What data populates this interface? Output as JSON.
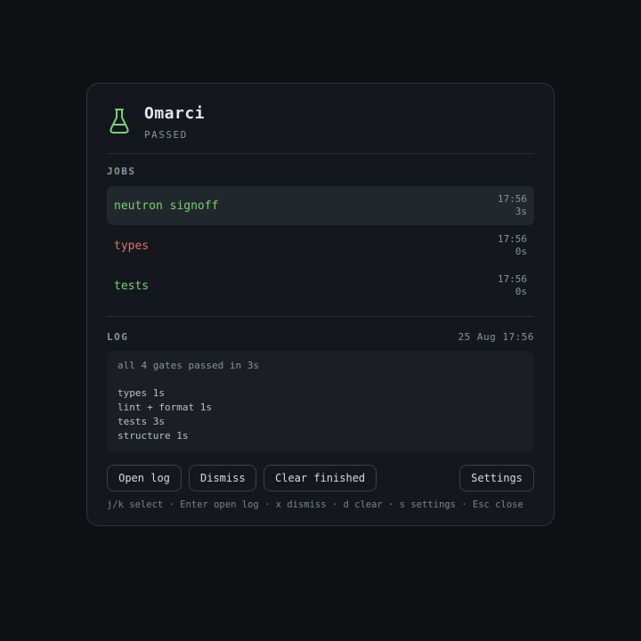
{
  "app": {
    "title": "Omarci",
    "status": "PASSED",
    "icon": "flask-icon",
    "accent": "#7ccf7a"
  },
  "jobs": {
    "label": "JOBS",
    "items": [
      {
        "name": "neutron signoff",
        "time": "17:56",
        "duration": "3s",
        "state": "ok",
        "selected": true
      },
      {
        "name": "types",
        "time": "17:56",
        "duration": "0s",
        "state": "fail",
        "selected": false
      },
      {
        "name": "tests",
        "time": "17:56",
        "duration": "0s",
        "state": "ok",
        "selected": false
      }
    ]
  },
  "log": {
    "label": "LOG",
    "timestamp": "25 Aug 17:56",
    "summary": "all 4 gates passed in 3s",
    "lines": [
      "types 1s",
      "lint + format 1s",
      "tests 3s",
      "structure 1s"
    ]
  },
  "actions": {
    "open_log": "Open log",
    "dismiss": "Dismiss",
    "clear_finished": "Clear finished",
    "settings": "Settings"
  },
  "hint": "j/k select · Enter open log · x dismiss · d clear · s settings · Esc close",
  "colors": {
    "ok": "#7ccf7a",
    "fail": "#e0706b",
    "background": "#0e1114",
    "card": "#14181c"
  }
}
